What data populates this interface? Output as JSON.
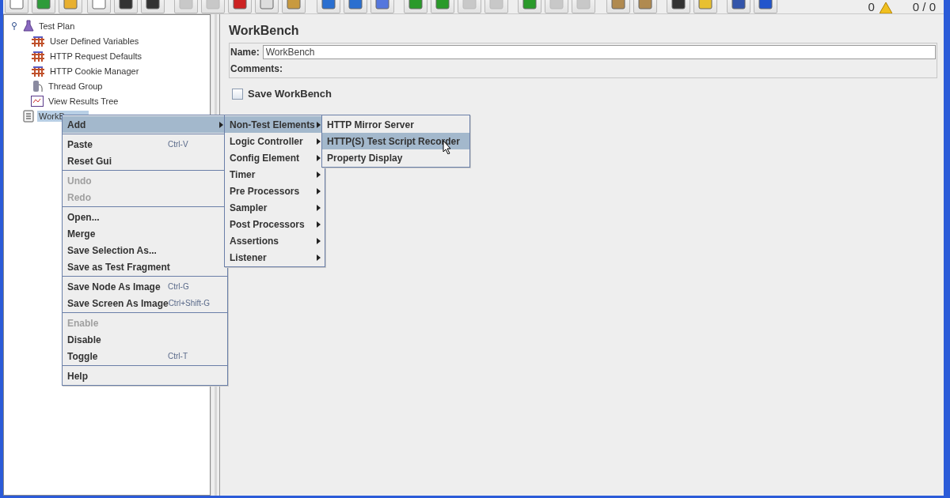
{
  "toolbar": {
    "buttons": [
      {
        "disabled": false
      },
      {
        "disabled": false
      },
      {
        "disabled": false
      },
      {
        "disabled": false
      },
      {
        "disabled": false
      },
      {
        "disabled": false
      },
      {
        "disabled": true
      },
      {
        "disabled": true
      },
      {
        "disabled": false
      },
      {
        "disabled": false
      },
      {
        "disabled": false
      },
      {
        "disabled": false
      },
      {
        "disabled": false
      },
      {
        "disabled": false
      },
      {
        "disabled": false
      },
      {
        "disabled": false
      },
      {
        "disabled": true
      },
      {
        "disabled": true
      },
      {
        "disabled": false
      },
      {
        "disabled": true
      },
      {
        "disabled": true
      },
      {
        "disabled": false
      },
      {
        "disabled": false
      },
      {
        "disabled": false
      },
      {
        "disabled": false
      },
      {
        "disabled": false
      },
      {
        "disabled": false
      }
    ],
    "warning_count": "0",
    "thread_count": "0 / 0"
  },
  "tree": [
    {
      "label": "Test Plan",
      "kind": "plan",
      "expanded": true,
      "selected": false,
      "children": [
        {
          "label": "User Defined Variables",
          "kind": "config",
          "selected": false
        },
        {
          "label": "HTTP Request Defaults",
          "kind": "config",
          "selected": false
        },
        {
          "label": "HTTP Cookie Manager",
          "kind": "config",
          "selected": false
        },
        {
          "label": "Thread Group",
          "kind": "thread",
          "selected": false
        },
        {
          "label": "View Results Tree",
          "kind": "listener",
          "selected": false
        }
      ]
    },
    {
      "label": "WorkB",
      "kind": "workbench",
      "selected": true
    }
  ],
  "panel": {
    "title": "WorkBench",
    "name_label": "Name:",
    "name_value": "WorkBench",
    "comments_label": "Comments:",
    "save_checkbox": {
      "label": "Save WorkBench",
      "checked": false
    }
  },
  "context_menu": {
    "groups": [
      [
        {
          "label": "Add",
          "kind": "submenu",
          "selected": true,
          "disabled": false
        }
      ],
      [
        {
          "label": "Paste",
          "shortcut": "Ctrl-V",
          "kind": "item",
          "selected": false,
          "disabled": false
        },
        {
          "label": "Reset Gui",
          "kind": "item",
          "selected": false,
          "disabled": false
        }
      ],
      [
        {
          "label": "Undo",
          "kind": "item",
          "selected": false,
          "disabled": true
        },
        {
          "label": "Redo",
          "kind": "item",
          "selected": false,
          "disabled": true
        }
      ],
      [
        {
          "label": "Open...",
          "kind": "item",
          "selected": false,
          "disabled": false
        },
        {
          "label": "Merge",
          "kind": "item",
          "selected": false,
          "disabled": false
        },
        {
          "label": "Save Selection As...",
          "kind": "item",
          "selected": false,
          "disabled": false
        },
        {
          "label": "Save as Test Fragment",
          "kind": "item",
          "selected": false,
          "disabled": false
        }
      ],
      [
        {
          "label": "Save Node As Image",
          "shortcut": "Ctrl-G",
          "kind": "item",
          "selected": false,
          "disabled": false
        },
        {
          "label": "Save Screen As Image",
          "shortcut": "Ctrl+Shift-G",
          "kind": "item",
          "selected": false,
          "disabled": false
        }
      ],
      [
        {
          "label": "Enable",
          "kind": "item",
          "selected": false,
          "disabled": true
        },
        {
          "label": "Disable",
          "kind": "item",
          "selected": false,
          "disabled": false
        },
        {
          "label": "Toggle",
          "shortcut": "Ctrl-T",
          "kind": "item",
          "selected": false,
          "disabled": false
        }
      ],
      [
        {
          "label": "Help",
          "kind": "item",
          "selected": false,
          "disabled": false
        }
      ]
    ]
  },
  "add_submenu": [
    {
      "label": "Non-Test Elements",
      "kind": "submenu",
      "selected": true
    },
    {
      "label": "Logic Controller",
      "kind": "submenu",
      "selected": false
    },
    {
      "label": "Config Element",
      "kind": "submenu",
      "selected": false
    },
    {
      "label": "Timer",
      "kind": "submenu",
      "selected": false
    },
    {
      "label": "Pre Processors",
      "kind": "submenu",
      "selected": false
    },
    {
      "label": "Sampler",
      "kind": "submenu",
      "selected": false
    },
    {
      "label": "Post Processors",
      "kind": "submenu",
      "selected": false
    },
    {
      "label": "Assertions",
      "kind": "submenu",
      "selected": false
    },
    {
      "label": "Listener",
      "kind": "submenu",
      "selected": false
    }
  ],
  "non_test_submenu": [
    {
      "label": "HTTP Mirror Server",
      "kind": "item",
      "selected": false
    },
    {
      "label": "HTTP(S) Test Script Recorder",
      "kind": "item",
      "selected": true
    },
    {
      "label": "Property Display",
      "kind": "item",
      "selected": false
    }
  ]
}
